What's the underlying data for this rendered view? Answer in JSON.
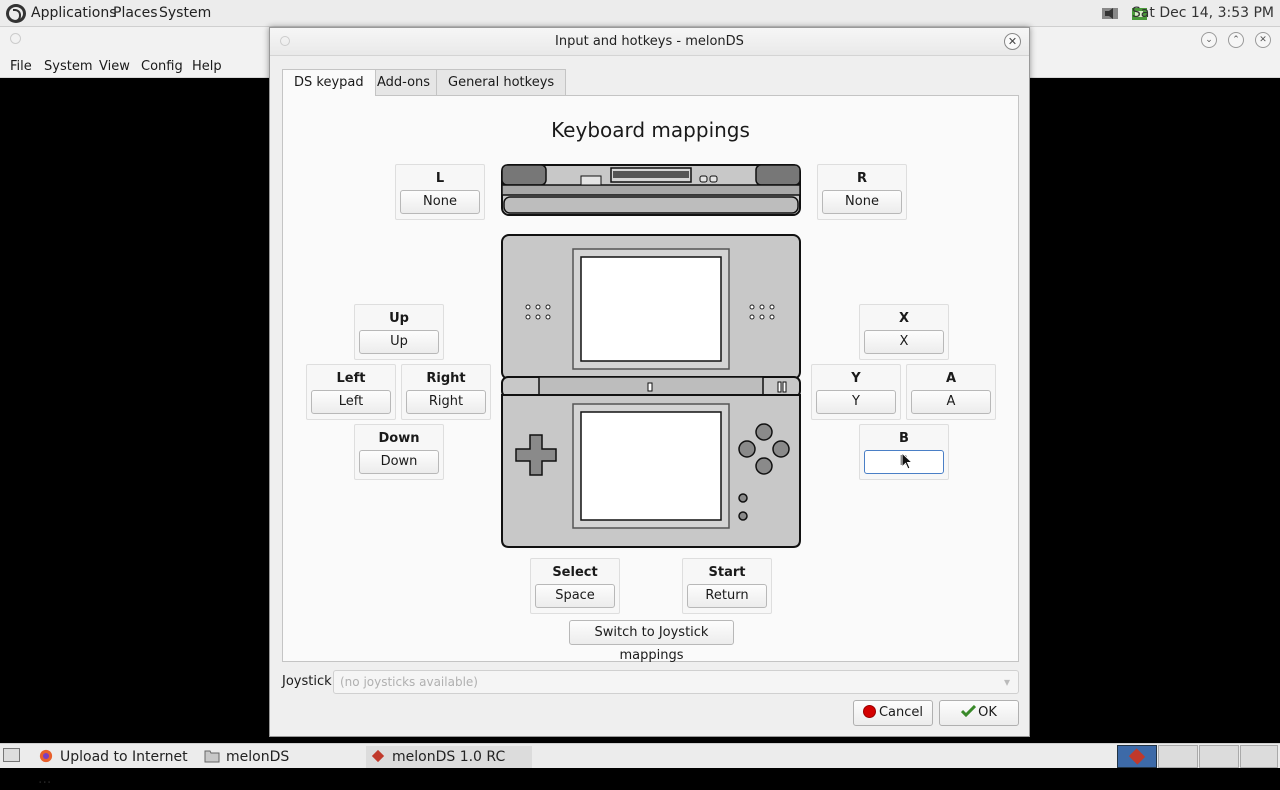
{
  "top_panel": {
    "menus": [
      "Applications",
      "Places",
      "System"
    ],
    "clock": "Sat Dec 14,  3:53 PM"
  },
  "main_window": {
    "menus": [
      "File",
      "System",
      "View",
      "Config",
      "Help"
    ]
  },
  "dialog": {
    "title": "Input and hotkeys - melonDS",
    "close_glyph": "✕",
    "tabs": [
      "DS keypad",
      "Add-ons",
      "General hotkeys"
    ],
    "active_tab": "DS keypad",
    "heading": "Keyboard mappings",
    "keys": {
      "l": {
        "label": "L",
        "value": "None"
      },
      "r": {
        "label": "R",
        "value": "None"
      },
      "up": {
        "label": "Up",
        "value": "Up"
      },
      "left": {
        "label": "Left",
        "value": "Left"
      },
      "right": {
        "label": "Right",
        "value": "Right"
      },
      "down": {
        "label": "Down",
        "value": "Down"
      },
      "x": {
        "label": "X",
        "value": "X"
      },
      "y": {
        "label": "Y",
        "value": "Y"
      },
      "a": {
        "label": "A",
        "value": "A"
      },
      "b": {
        "label": "B",
        "value": "B"
      },
      "select": {
        "label": "Select",
        "value": "Space"
      },
      "start": {
        "label": "Start",
        "value": "Return"
      }
    },
    "switch_button": "Switch to Joystick mappings",
    "joystick_label": "Joystick:",
    "joystick_value": "(no joysticks available)",
    "cancel": "Cancel",
    "ok": "OK"
  },
  "taskbar": {
    "items": [
      "Upload to Internet ...",
      "melonDS",
      "melonDS 1.0 RC"
    ]
  },
  "colors": {
    "accent_focus": "#4a7fc6",
    "cancel_red": "#d40000",
    "ok_green": "#3a8a2a"
  }
}
